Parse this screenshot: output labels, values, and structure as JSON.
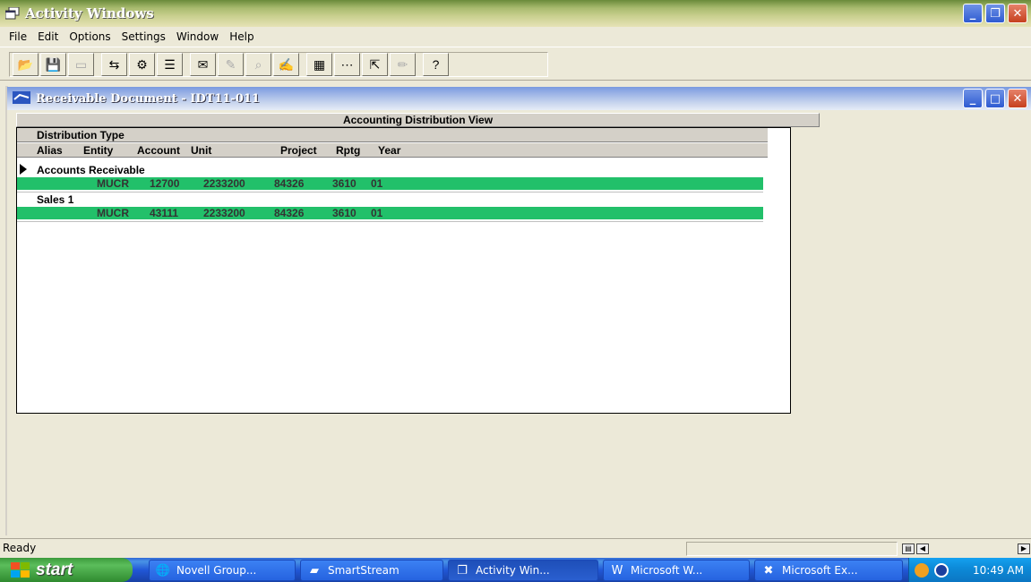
{
  "window": {
    "title": "Activity Windows"
  },
  "menu": [
    "File",
    "Edit",
    "Options",
    "Settings",
    "Window",
    "Help"
  ],
  "toolbar": {
    "buttons": [
      {
        "icon": "open-folder-icon",
        "glyph": "📂"
      },
      {
        "icon": "save-icon",
        "glyph": "💾"
      },
      {
        "icon": "blank-page-icon",
        "glyph": "▭"
      },
      {
        "icon": "transfer-icon",
        "glyph": "⇆"
      },
      {
        "icon": "network-icon",
        "glyph": "⚙"
      },
      {
        "icon": "list-icon",
        "glyph": "☰"
      },
      {
        "icon": "edit-form-icon",
        "glyph": "✉"
      },
      {
        "icon": "disabled-tool-icon",
        "glyph": "✎"
      },
      {
        "icon": "search-icon",
        "glyph": "⌕"
      },
      {
        "icon": "edit-note-icon",
        "glyph": "✍"
      },
      {
        "icon": "calculator-icon",
        "glyph": "▦"
      },
      {
        "icon": "chart-icon",
        "glyph": "⋯"
      },
      {
        "icon": "export-icon",
        "glyph": "⇱"
      },
      {
        "icon": "pencil-icon",
        "glyph": "✏"
      },
      {
        "icon": "help-icon",
        "glyph": "?"
      }
    ]
  },
  "child_window": {
    "title": "Receivable Document - IDT11-011"
  },
  "grid": {
    "view_title": "Accounting Distribution View",
    "group_header": "Distribution Type",
    "columns": [
      "Alias",
      "Entity",
      "Account",
      "Unit",
      "Project",
      "Rptg",
      "Year"
    ],
    "groups": [
      {
        "label": "Accounts Receivable",
        "rows": [
          {
            "entity": "MUCR",
            "account": "12700",
            "unit": "2233200",
            "project": "84326",
            "rptg": "3610",
            "year": "01"
          }
        ]
      },
      {
        "label": "Sales 1",
        "rows": [
          {
            "entity": "MUCR",
            "account": "43111",
            "unit": "2233200",
            "project": "84326",
            "rptg": "3610",
            "year": "01"
          }
        ]
      }
    ]
  },
  "status": {
    "text": "Ready"
  },
  "taskbar": {
    "start_label": "start",
    "tasks": [
      "Novell Group...",
      "SmartStream",
      "Activity Win...",
      "Microsoft W...",
      "Microsoft Ex..."
    ],
    "clock": "10:49 AM"
  },
  "colors": {
    "row_highlight": "#22c06a",
    "titlebar": "#a9bb6f",
    "child_titlebar": "#a8bde8",
    "taskbar": "#2157d7"
  }
}
